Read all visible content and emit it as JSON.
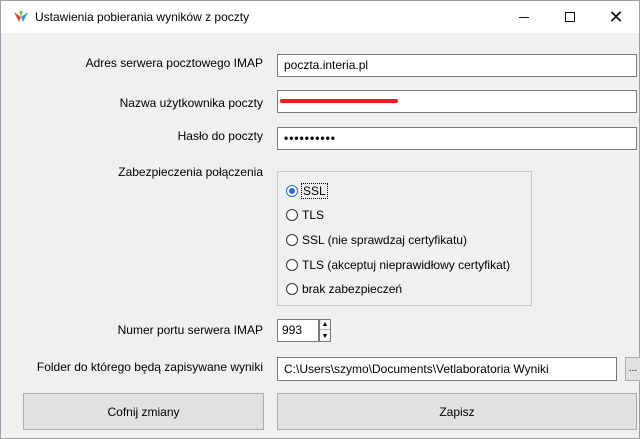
{
  "window": {
    "title": "Ustawienia pobierania wyników z poczty",
    "accent_color": "#1e6fd0"
  },
  "form": {
    "server_label": "Adres serwera pocztowego IMAP",
    "server_value": "poczta.interia.pl",
    "username_label": "Nazwa użytkownika poczty",
    "username_value": "",
    "password_label": "Hasło do poczty",
    "password_value": "••••••••••",
    "security_label": "Zabezpieczenia połączenia",
    "security_options": [
      {
        "label": "SSL",
        "checked": true
      },
      {
        "label": "TLS",
        "checked": false
      },
      {
        "label": "SSL (nie sprawdzaj certyfikatu)",
        "checked": false
      },
      {
        "label": "TLS (akceptuj nieprawidłowy certyfikat)",
        "checked": false
      },
      {
        "label": "brak zabezpieczeń",
        "checked": false
      }
    ],
    "port_label": "Numer portu serwera IMAP",
    "port_value": "993",
    "folder_label": "Folder do którego będą zapisywane wyniki",
    "folder_value": "C:\\Users\\szymo\\Documents\\Vetlaboratoria Wyniki",
    "browse_label": "..."
  },
  "buttons": {
    "cancel_label": "Cofnij zmiany",
    "save_label": "Zapisz"
  }
}
